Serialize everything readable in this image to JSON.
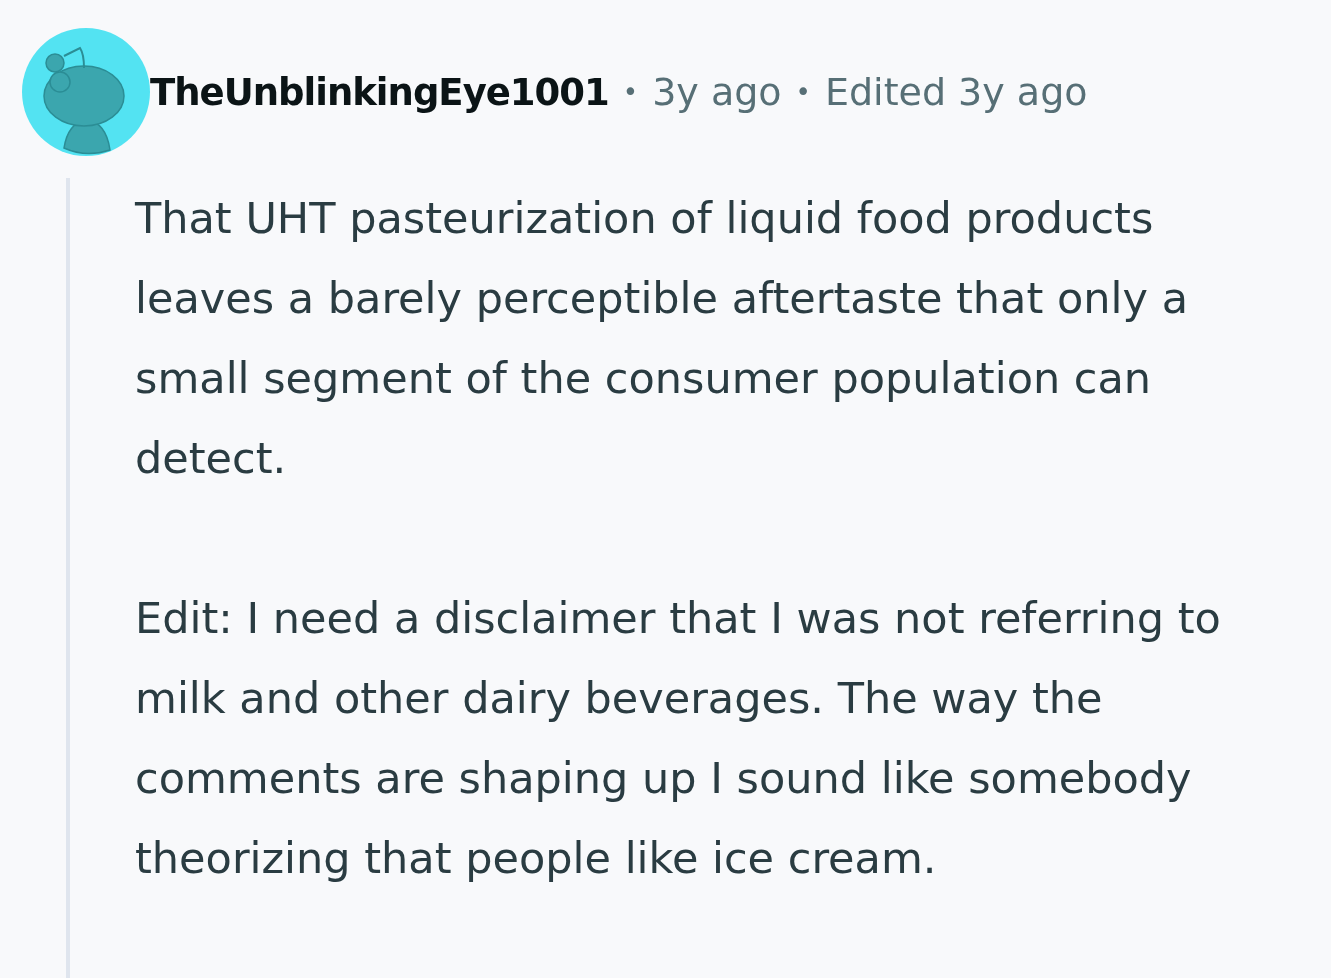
{
  "comment": {
    "author": "TheUnblinkingEye1001",
    "separator_1": "•",
    "posted": "3y ago",
    "separator_2": "•",
    "edited": "Edited 3y ago",
    "paragraphs": [
      "That UHT pasteurization of liquid food products leaves a barely perceptible aftertaste that only a small segment of the consumer population can detect.",
      "Edit: I need a disclaimer that I was not referring to milk and other dairy beverages. The way the comments are shaping up I sound like somebody theorizing that people like ice cream."
    ]
  }
}
